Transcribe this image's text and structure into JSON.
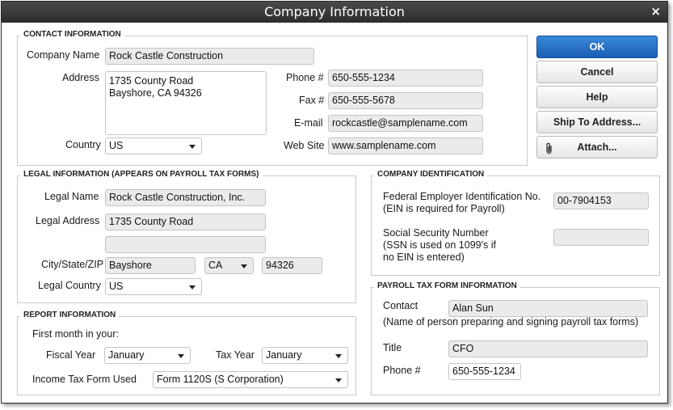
{
  "window": {
    "title": "Company Information",
    "close_glyph": "×"
  },
  "contact": {
    "section_title": "CONTACT INFORMATION",
    "company_name_label": "Company Name",
    "company_name_value": "Rock Castle Construction",
    "address_label": "Address",
    "address_line1": "1735 County Road",
    "address_line2": "Bayshore, CA 94326",
    "country_label": "Country",
    "country_value": "US",
    "phone_label": "Phone #",
    "phone_value": "650-555-1234",
    "fax_label": "Fax #",
    "fax_value": "650-555-5678",
    "email_label": "E-mail",
    "email_value": "rockcastle@samplename.com",
    "website_label": "Web Site",
    "website_value": "www.samplename.com"
  },
  "legal": {
    "section_title": "LEGAL INFORMATION (APPEARS ON PAYROLL TAX FORMS)",
    "legal_name_label": "Legal Name",
    "legal_name_value": "Rock Castle Construction, Inc.",
    "legal_address_label": "Legal Address",
    "legal_address_value": "1735 County Road",
    "legal_address2_value": "",
    "city_state_zip_label": "City/State/ZIP",
    "city_value": "Bayshore",
    "state_value": "CA",
    "zip_value": "94326",
    "legal_country_label": "Legal Country",
    "legal_country_value": "US"
  },
  "report": {
    "section_title": "REPORT INFORMATION",
    "first_month_label": "First month in your:",
    "fiscal_year_label": "Fiscal Year",
    "fiscal_year_value": "January",
    "tax_year_label": "Tax Year",
    "tax_year_value": "January",
    "income_tax_form_label": "Income Tax Form Used",
    "income_tax_form_value": "Form 1120S (S Corporation)"
  },
  "company_id": {
    "section_title": "COMPANY IDENTIFICATION",
    "ein_label_line1": "Federal Employer Identification No.",
    "ein_label_line2": "(EIN is required for Payroll)",
    "ein_value": "00-7904153",
    "ssn_label_line1": "Social Security Number",
    "ssn_label_line2": "(SSN is used on 1099's if",
    "ssn_label_line3": "no EIN is entered)",
    "ssn_value": ""
  },
  "payroll": {
    "section_title": "PAYROLL TAX FORM INFORMATION",
    "contact_label": "Contact",
    "contact_value": "Alan Sun",
    "contact_note": "(Name of person preparing and signing payroll tax forms)",
    "title_label": "Title",
    "title_value": "CFO",
    "phone_label": "Phone #",
    "phone_value": "650-555-1234"
  },
  "buttons": {
    "ok": "OK",
    "cancel": "Cancel",
    "help": "Help",
    "ship_to": "Ship To Address...",
    "attach": "Attach...",
    "attach_icon": "paperclip-icon"
  },
  "colors": {
    "titlebar": "#333333",
    "ok_button": "#2a71c6",
    "field_bg": "#ebebeb"
  }
}
